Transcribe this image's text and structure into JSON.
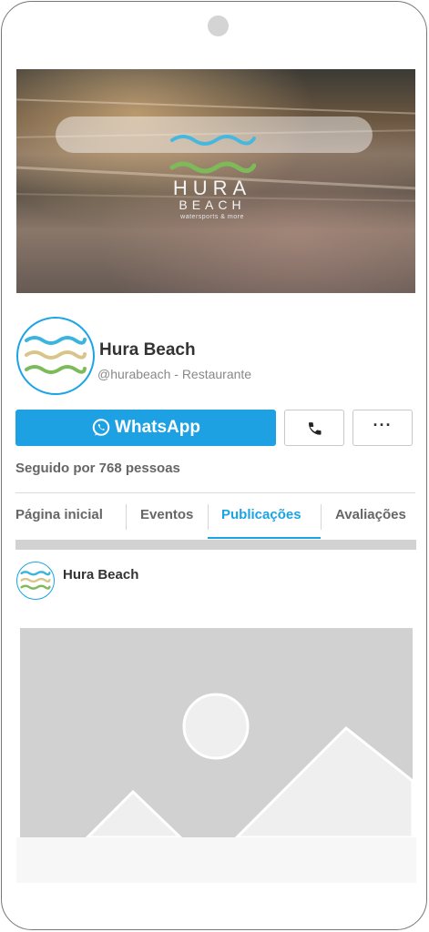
{
  "cover": {
    "logo_line1": "HURA",
    "logo_line2": "BEACH",
    "logo_tagline": "watersports & more"
  },
  "profile": {
    "name": "Hura Beach",
    "handle": "@hurabeach - Restaurante"
  },
  "actions": {
    "whatsapp_label": "WhatsApp",
    "more_label": "···"
  },
  "followers_text": "Seguido por 768 pessoas",
  "tabs": [
    {
      "label": "Página inicial",
      "active": false
    },
    {
      "label": "Eventos",
      "active": false
    },
    {
      "label": "Publicações",
      "active": true
    },
    {
      "label": "Avaliações",
      "active": false
    }
  ],
  "post": {
    "author": "Hura Beach"
  },
  "colors": {
    "accent": "#1aa4e6",
    "whatsapp_button": "#1ea1e3",
    "logo_wave_blue": "#3bb4de",
    "logo_wave_sand": "#d9c58a",
    "logo_wave_green": "#7dba5a"
  }
}
